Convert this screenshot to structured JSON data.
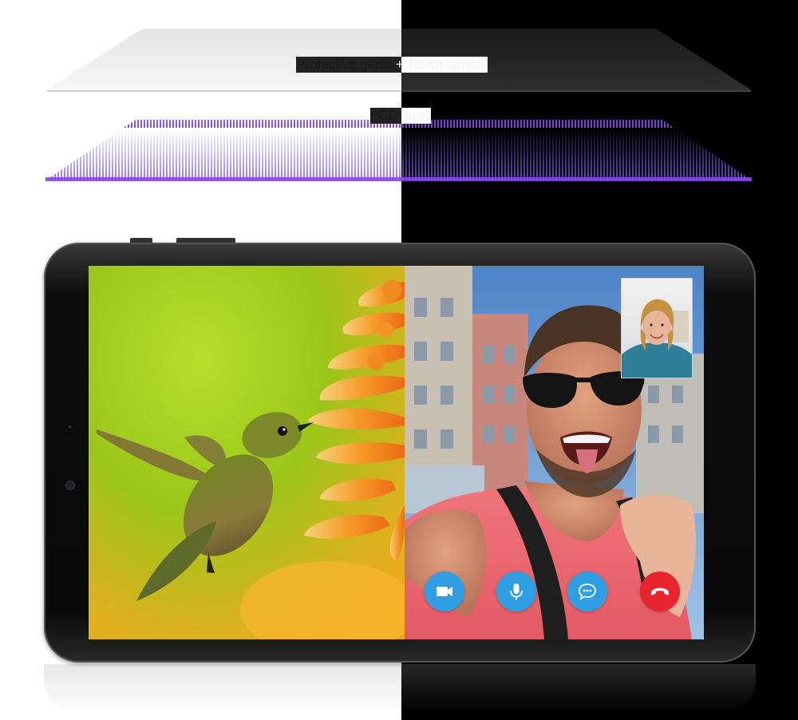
{
  "layers": {
    "glass_label_left": "Protective glass",
    "glass_label_right": " + Touch sensor",
    "lcd_label_left": "LCD ",
    "lcd_label_right": "layer"
  },
  "call_controls": {
    "buttons": [
      {
        "icon": "video-camera-icon",
        "color": "#2f9ee3"
      },
      {
        "icon": "microphone-icon",
        "color": "#2f9ee3"
      },
      {
        "icon": "chat-bubble-icon",
        "color": "#2f9ee3"
      },
      {
        "icon": "hang-up-icon",
        "color": "#e8252e"
      }
    ]
  },
  "colors": {
    "lcd_gradient_start": "#6a3cf0",
    "lcd_gradient_end": "#9a4ae8",
    "background_left": "#ffffff",
    "background_right": "#000000"
  }
}
